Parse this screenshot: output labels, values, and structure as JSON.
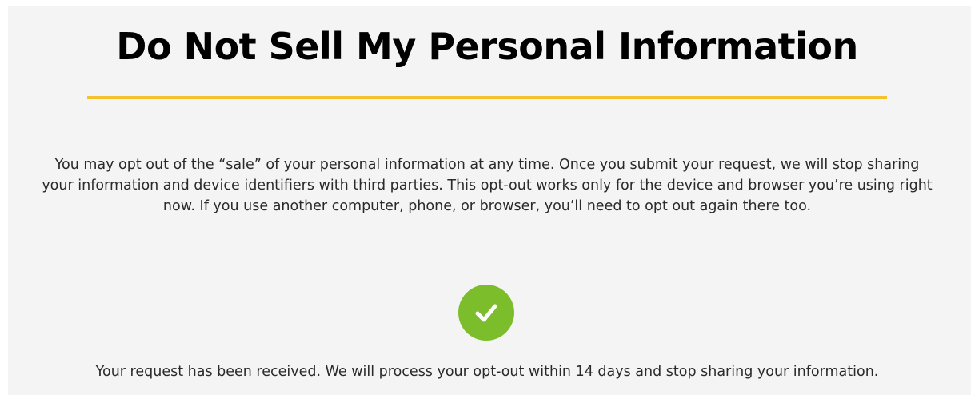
{
  "page": {
    "title": "Do Not Sell My Personal Information",
    "intro": "You may opt out of the “sale” of your personal information at any time. Once you submit your request, we will stop sharing your information and device identifiers with third parties. This opt-out works only for the device and browser you’re using right now. If you use another computer, phone, or browser, you’ll need to opt out again there too.",
    "confirmation": "Your request has been received. We will process your opt-out within 14 days and stop sharing your information."
  },
  "icons": {
    "success": "check-circle-icon"
  },
  "colors": {
    "panel_background": "#f4f4f4",
    "accent_divider": "#f4c12f",
    "success_green": "#7cbd2c",
    "title_text": "#000000",
    "body_text": "#2a2a2a"
  }
}
